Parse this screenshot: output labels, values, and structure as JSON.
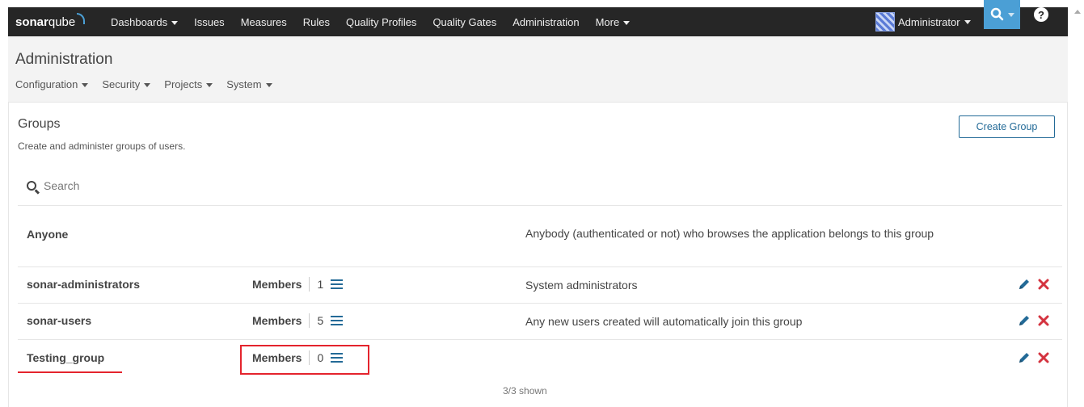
{
  "topnav": {
    "logo_bold": "sonar",
    "logo_light": "qube",
    "links": [
      {
        "label": "Dashboards",
        "caret": true
      },
      {
        "label": "Issues"
      },
      {
        "label": "Measures"
      },
      {
        "label": "Rules"
      },
      {
        "label": "Quality Profiles"
      },
      {
        "label": "Quality Gates"
      },
      {
        "label": "Administration"
      },
      {
        "label": "More",
        "caret": true
      }
    ],
    "user": "Administrator",
    "help": "?"
  },
  "admin": {
    "title": "Administration",
    "subnav": [
      "Configuration",
      "Security",
      "Projects",
      "System"
    ]
  },
  "groups": {
    "title": "Groups",
    "description": "Create and administer groups of users.",
    "create_button": "Create Group",
    "search_placeholder": "Search",
    "members_label": "Members",
    "rows": [
      {
        "name": "Anyone",
        "description": "Anybody (authenticated or not) who browses the application belongs to this group"
      },
      {
        "name": "sonar-administrators",
        "members": "1",
        "description": "System administrators"
      },
      {
        "name": "sonar-users",
        "members": "5",
        "description": "Any new users created will automatically join this group"
      },
      {
        "name": "Testing_group",
        "members": "0",
        "description": ""
      }
    ],
    "shown": "3/3 shown"
  },
  "colors": {
    "nav_bg": "#262626",
    "accent": "#4b9fd5",
    "link": "#236a97",
    "delete": "#d4333f",
    "highlight": "#e4242d"
  }
}
